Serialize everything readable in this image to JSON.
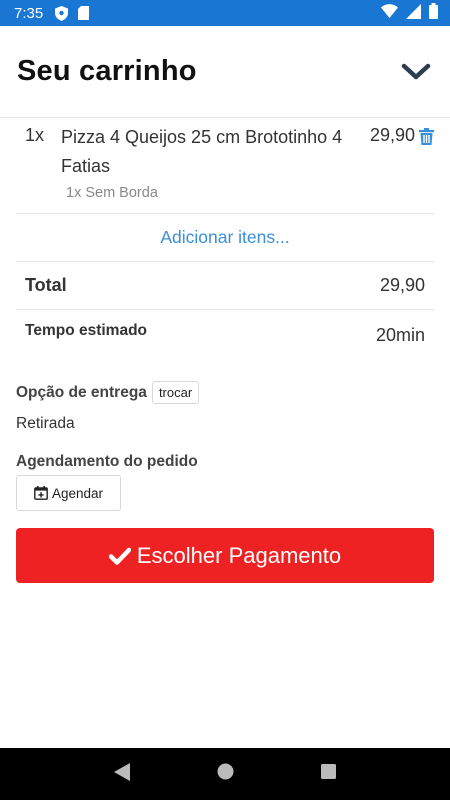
{
  "status_bar": {
    "time": "7:35",
    "icons": [
      "shield-icon",
      "sd-card-icon",
      "wifi-icon",
      "signal-icon",
      "battery-icon"
    ],
    "background": "#1976d2"
  },
  "header": {
    "title": "Seu carrinho",
    "collapse_icon": "chevron-down-icon"
  },
  "cart": {
    "items": [
      {
        "quantity": "1x",
        "name": "Pizza 4 Queijos 25 cm Brototinho 4 Fatias",
        "option": "1x Sem Borda",
        "price": "29,90",
        "remove_icon": "trash-icon"
      }
    ],
    "add_items_label": "Adicionar itens..."
  },
  "summary": {
    "total_label": "Total",
    "total_value": "29,90",
    "time_label": "Tempo estimado",
    "time_value": "20min"
  },
  "delivery": {
    "title": "Opção de entrega",
    "change_label": "trocar",
    "mode": "Retirada"
  },
  "schedule": {
    "title": "Agendamento do pedido",
    "button_label": "Agendar",
    "button_icon": "calendar-plus-icon"
  },
  "payment": {
    "button_label": "Escolher Pagamento",
    "button_icon": "check-icon",
    "color": "#ee2222"
  },
  "colors": {
    "link": "#3a8fd9",
    "trash": "#3a8fd9"
  },
  "nav_bar": {
    "icons": [
      "back-icon",
      "home-icon",
      "recents-icon"
    ]
  }
}
